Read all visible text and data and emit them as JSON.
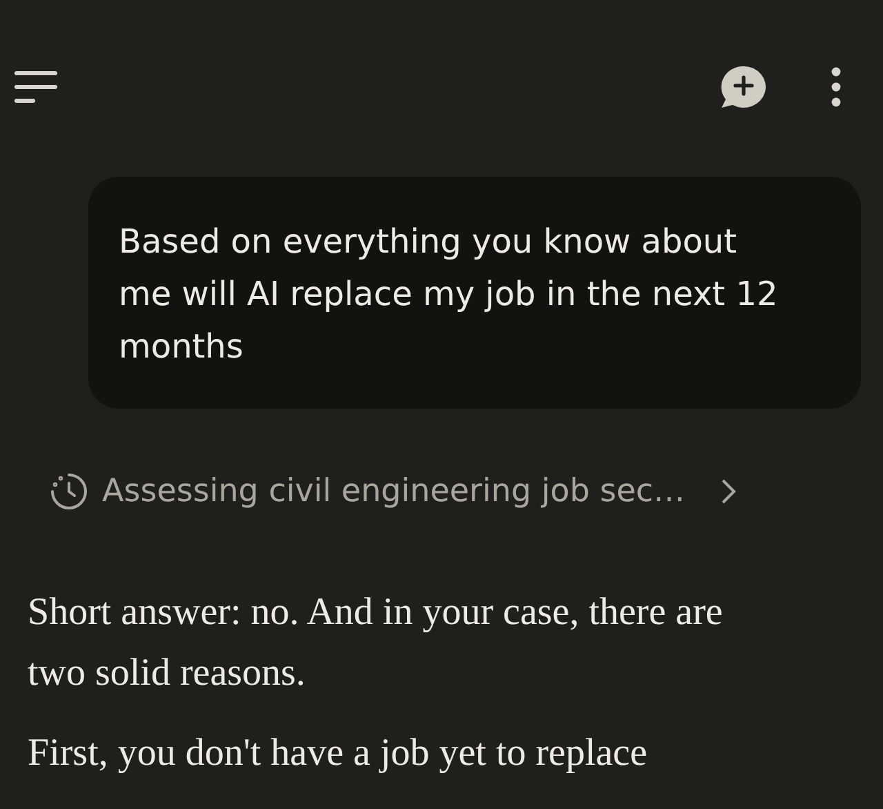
{
  "user_message": {
    "text": "Based on everything you know about me will AI replace my job in the next 12 months"
  },
  "thinking_status": {
    "text": "Assessing civil engineering job sec…"
  },
  "answer": {
    "paragraphs": [
      "Short answer: no. And in your case, there are two solid reasons.",
      "First, you don't have a job yet to replace"
    ]
  }
}
